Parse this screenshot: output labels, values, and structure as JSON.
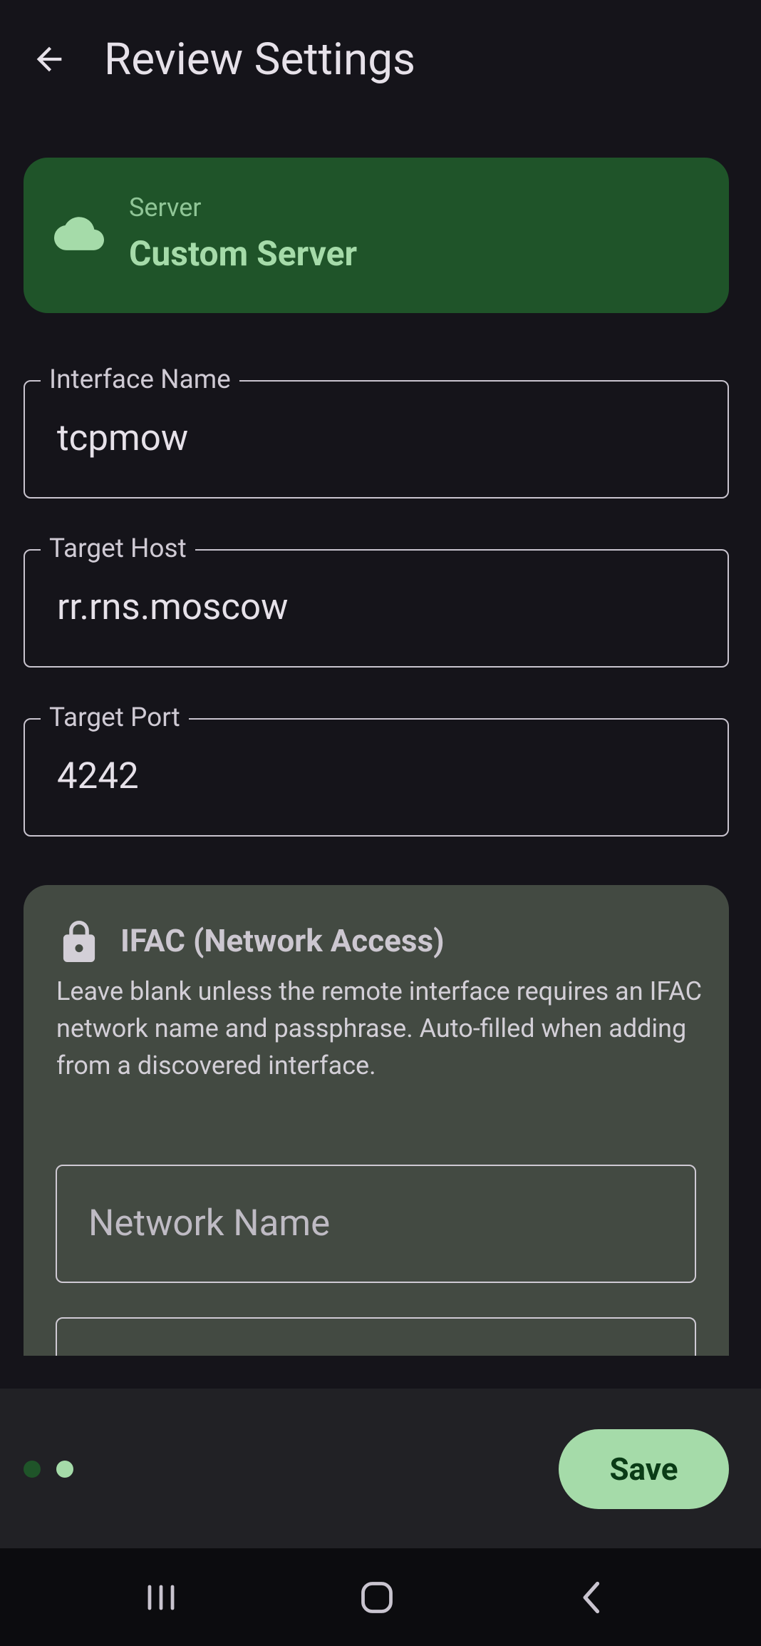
{
  "appbar": {
    "title": "Review Settings",
    "back_icon": "arrow-back-icon"
  },
  "server_card": {
    "icon": "cloud-icon",
    "label": "Server",
    "value": "Custom Server"
  },
  "fields": {
    "interface_name": {
      "label": "Interface Name",
      "value": "tcpmow"
    },
    "target_host": {
      "label": "Target Host",
      "value": "rr.rns.moscow"
    },
    "target_port": {
      "label": "Target Port",
      "value": "4242"
    }
  },
  "ifac": {
    "icon": "lock-icon",
    "title": "IFAC (Network Access)",
    "description": "Leave blank unless the remote interface requires an IFAC network name and passphrase. Auto-filled when adding from a discovered interface.",
    "network_name": {
      "placeholder": "Network Name",
      "value": ""
    }
  },
  "bottom_bar": {
    "pager_dots": 2,
    "current_page": 2,
    "save_label": "Save"
  },
  "system_nav": {
    "recents": "recents-icon",
    "home": "home-icon",
    "back": "back-chevron-icon"
  },
  "colors": {
    "background": "#15141a",
    "server_card": "#1f5429",
    "accent": "#a5dba9",
    "ifac_card": "#434a42",
    "bottom_bar": "#212125"
  }
}
